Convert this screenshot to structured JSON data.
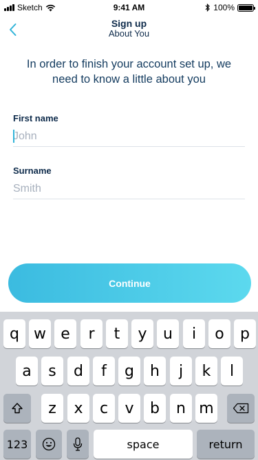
{
  "status_bar": {
    "carrier": "Sketch",
    "time": "9:41 AM",
    "battery": "100%"
  },
  "nav": {
    "title": "Sign up",
    "subtitle": "About You"
  },
  "intro": "In order to finish your account set up, we need to know a little about you",
  "form": {
    "first_name": {
      "label": "First name",
      "placeholder": "John",
      "value": ""
    },
    "surname": {
      "label": "Surname",
      "placeholder": "Smith",
      "value": ""
    }
  },
  "continue_label": "Continue",
  "keyboard": {
    "row1": [
      "q",
      "w",
      "e",
      "r",
      "t",
      "y",
      "u",
      "i",
      "o",
      "p"
    ],
    "row2": [
      "a",
      "s",
      "d",
      "f",
      "g",
      "h",
      "j",
      "k",
      "l"
    ],
    "row3": [
      "z",
      "x",
      "c",
      "v",
      "b",
      "n",
      "m"
    ],
    "numbers_label": "123",
    "space_label": "space",
    "return_label": "return"
  },
  "colors": {
    "accent": "#3bbbe0",
    "text": "#0d2a4a",
    "keyboard_bg": "#d1d4d9"
  }
}
